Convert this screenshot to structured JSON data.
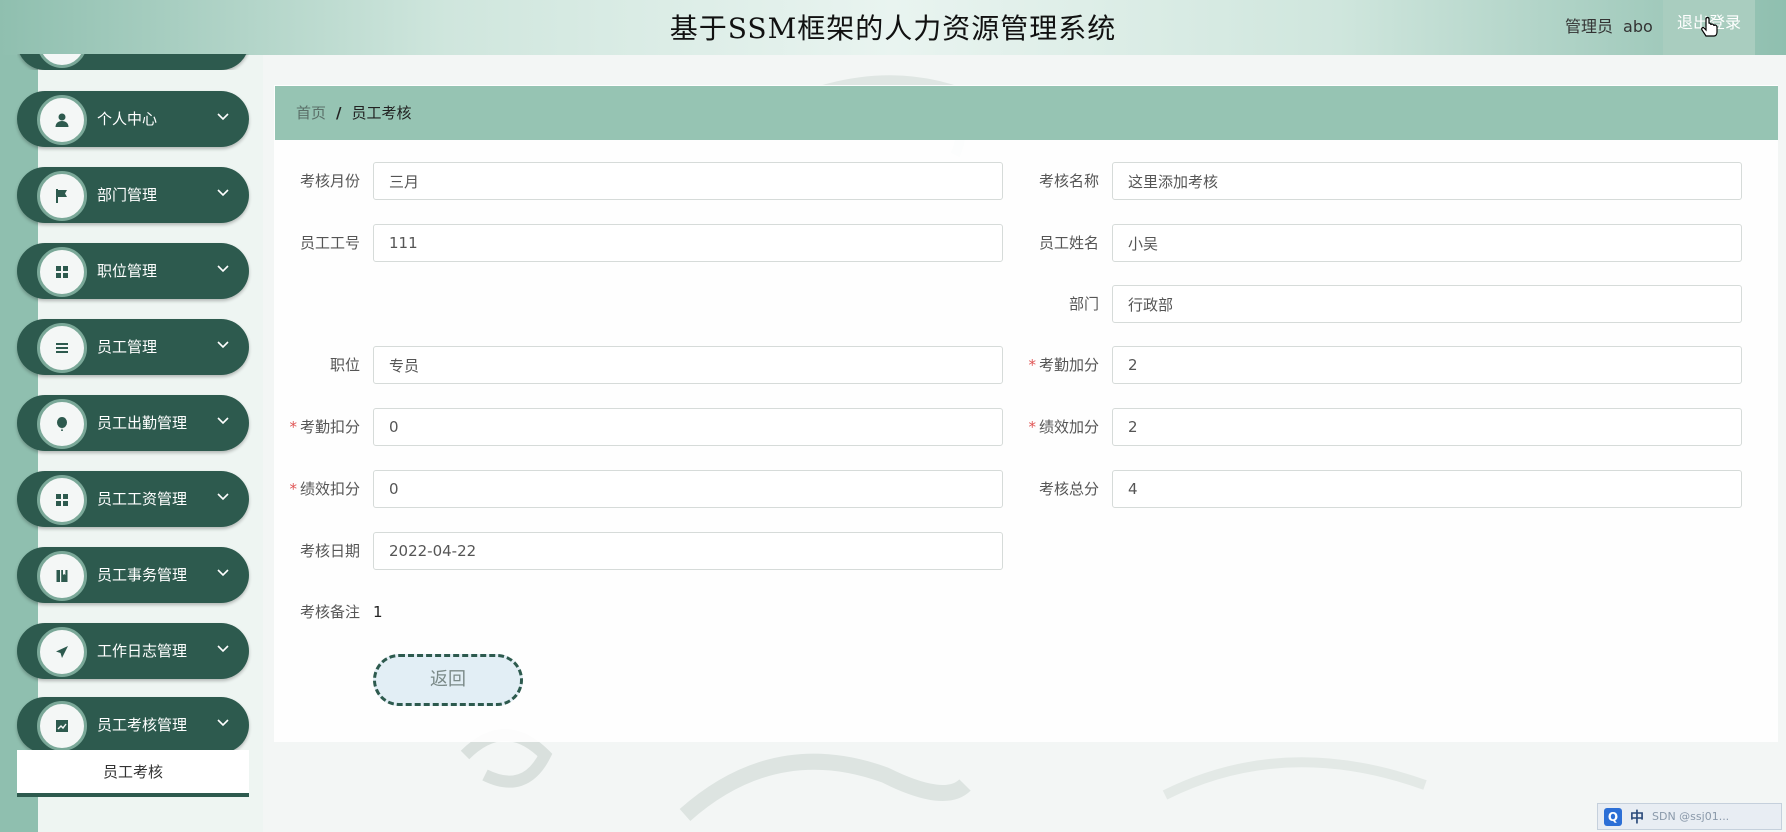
{
  "header": {
    "title": "基于SSM框架的人力资源管理系统",
    "user_role": "管理员",
    "username": "abo",
    "logout_label": "退出登录"
  },
  "sidebar": {
    "items": [
      {
        "label": "个人中心",
        "icon": "person-icon"
      },
      {
        "label": "部门管理",
        "icon": "flag-icon"
      },
      {
        "label": "职位管理",
        "icon": "grid-icon"
      },
      {
        "label": "员工管理",
        "icon": "list-icon"
      },
      {
        "label": "员工出勤管理",
        "icon": "balloon-icon"
      },
      {
        "label": "员工工资管理",
        "icon": "grid-icon"
      },
      {
        "label": "员工事务管理",
        "icon": "book-icon"
      },
      {
        "label": "工作日志管理",
        "icon": "paper-plane-icon"
      },
      {
        "label": "员工考核管理",
        "icon": "chart-icon"
      }
    ],
    "submenu": {
      "label": "员工考核"
    }
  },
  "breadcrumb": {
    "home": "首页",
    "separator": "/",
    "current": "员工考核"
  },
  "form": {
    "month": {
      "label": "考核月份",
      "value": "三月"
    },
    "name": {
      "label": "考核名称",
      "value": "这里添加考核"
    },
    "emp_no": {
      "label": "员工工号",
      "value": "111"
    },
    "emp_name": {
      "label": "员工姓名",
      "value": "小吴"
    },
    "dept": {
      "label": "部门",
      "value": "行政部"
    },
    "position": {
      "label": "职位",
      "value": "专员"
    },
    "attend_plus": {
      "label": "考勤加分",
      "value": "2",
      "required": true
    },
    "attend_minus": {
      "label": "考勤扣分",
      "value": "0",
      "required": true
    },
    "perf_plus": {
      "label": "绩效加分",
      "value": "2",
      "required": true
    },
    "perf_minus": {
      "label": "绩效扣分",
      "value": "0",
      "required": true
    },
    "total": {
      "label": "考核总分",
      "value": "4"
    },
    "date": {
      "label": "考核日期",
      "value": "2022-04-22"
    },
    "remark": {
      "label": "考核备注",
      "value": "1"
    },
    "back_label": "返回"
  },
  "ime": {
    "q": "Q",
    "lang": "中",
    "watermark": "SDN @ssj01..."
  },
  "colors": {
    "sidebar_item": "#2d5a4e",
    "breadcrumb_bg": "#96c4b3",
    "required": "#e05555"
  }
}
